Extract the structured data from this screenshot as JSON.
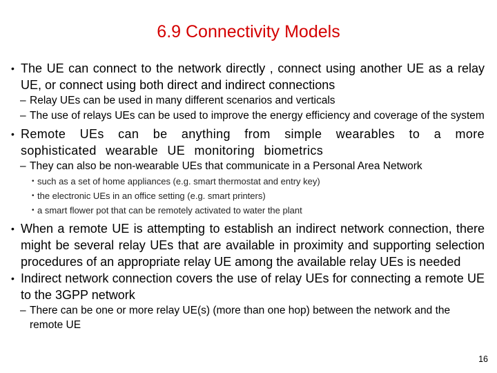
{
  "slide": {
    "title": "6.9 Connectivity Models",
    "title_color": "#d40000",
    "page_number": "16",
    "bullets": [
      {
        "text": "The UE can connect to the network directly , connect using another UE as a relay UE, or connect using both direct and indirect connections",
        "sub": [
          {
            "text": "Relay UEs can be used in many different scenarios and verticals"
          },
          {
            "text": "The use of relays UEs can be used to improve the energy efficiency and coverage of the system"
          }
        ]
      },
      {
        "text": " Remote UEs can be anything from simple wearables to a more sophisticated wearable UE monitoring biometrics",
        "sub": [
          {
            "text": "They can also be non-wearable UEs that communicate in a Personal Area Network",
            "sub": [
              {
                "text": "such as a set of home appliances (e.g. smart thermostat and entry key)"
              },
              {
                "text": "the electronic UEs in an office setting (e.g. smart printers)"
              },
              {
                "text": "a smart flower pot that can be remotely activated to water the plant"
              }
            ]
          }
        ]
      },
      {
        "text": "When a remote UE is attempting to establish an indirect network connection, there might be several relay UEs that are available in proximity and supporting selection procedures of an appropriate relay UE among the available relay UEs is needed",
        "sub": []
      },
      {
        "text": "Indirect network connection covers the use of relay UEs for connecting a remote UE to the 3GPP network",
        "sub": [
          {
            "text": "There can be one or more relay UE(s) (more than one hop) between the network and the remote UE"
          }
        ]
      }
    ]
  },
  "icons": {
    "bullet_l1": "•",
    "bullet_l2": "–",
    "bullet_l3": "•"
  }
}
